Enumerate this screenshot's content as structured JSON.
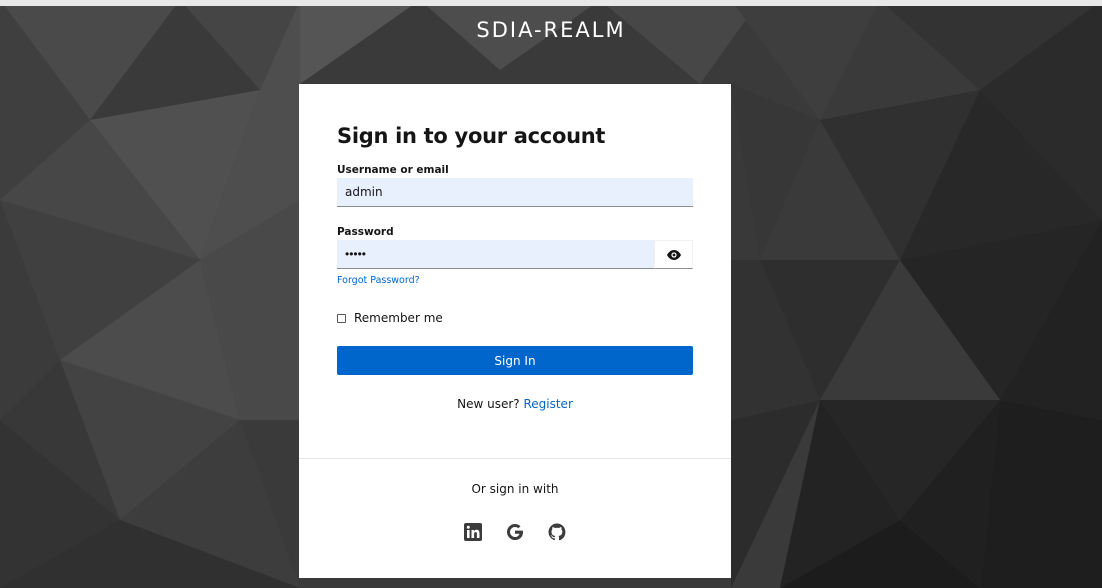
{
  "realm": {
    "title": "SDIA-REALM"
  },
  "login": {
    "heading": "Sign in to your account",
    "username_label": "Username or email",
    "username_value": "admin",
    "password_label": "Password",
    "password_value": "admin",
    "forgot_label": "Forgot Password?",
    "remember_label": "Remember me",
    "remember_checked": false,
    "signin_label": "Sign In",
    "new_user_text": "New user?",
    "register_label": "Register"
  },
  "social": {
    "or_text": "Or sign in with",
    "providers": [
      "linkedin-icon",
      "google-icon",
      "github-icon"
    ]
  },
  "colors": {
    "primary": "#0066cc",
    "input_bg": "#e8f0fe",
    "background": "#2a2a2a"
  }
}
